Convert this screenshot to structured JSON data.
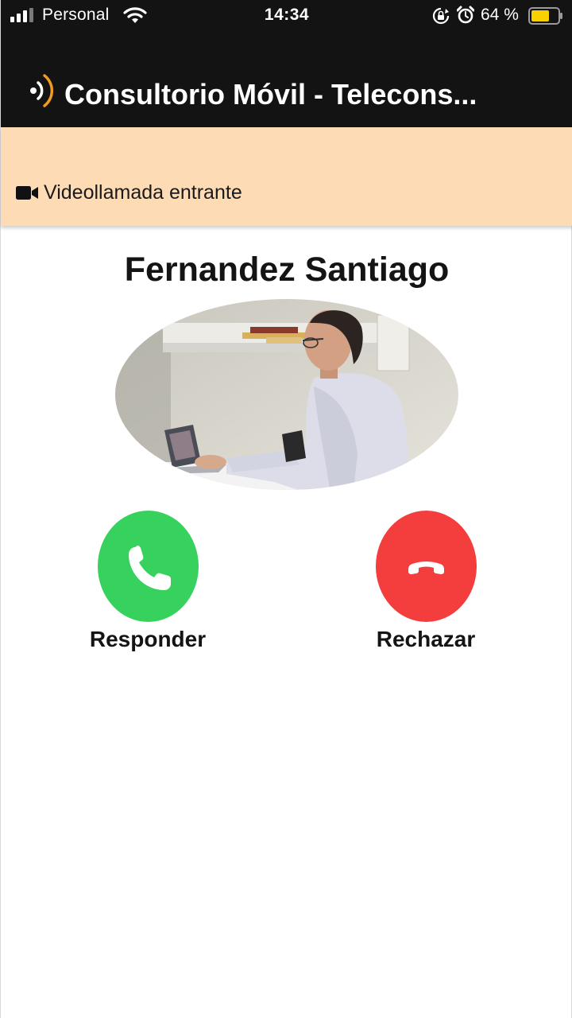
{
  "status_bar": {
    "carrier": "Personal",
    "time": "14:34",
    "battery_percent": "64 %",
    "icons": [
      "signal-icon",
      "wifi-icon",
      "rotation-lock-icon",
      "alarm-icon",
      "battery-icon"
    ]
  },
  "app_bar": {
    "title": "Consultorio Móvil - Telecons...",
    "logo_icon": "broadcast-logo-icon"
  },
  "banner": {
    "icon": "video-camera-icon",
    "text": "Videollamada entrante"
  },
  "caller": {
    "name": "Fernandez Santiago"
  },
  "actions": {
    "answer_label": "Responder",
    "reject_label": "Rechazar",
    "answer_icon": "phone-icon",
    "reject_icon": "hang-up-icon"
  },
  "colors": {
    "top_bar": "#131313",
    "banner_bg": "#fddcb5",
    "answer": "#37d15e",
    "reject": "#f43d3d",
    "logo_accent": "#f29a1f"
  }
}
